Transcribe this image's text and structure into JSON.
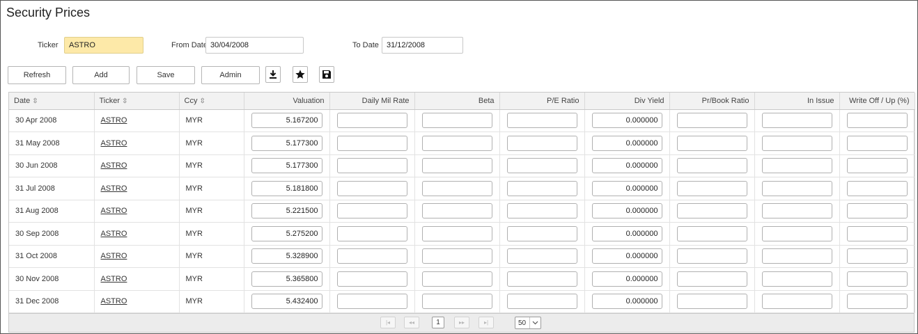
{
  "page": {
    "title": "Security Prices"
  },
  "filters": {
    "ticker_label": "Ticker",
    "ticker_value": "ASTRO",
    "from_label": "From Date*",
    "from_value": "30/04/2008",
    "to_label": "To Date",
    "to_value": "31/12/2008"
  },
  "toolbar": {
    "refresh_label": "Refresh",
    "add_label": "Add",
    "save_label": "Save",
    "admin_label": "Admin",
    "icons": [
      "download-icon",
      "star-icon",
      "floppy-disk-icon"
    ]
  },
  "grid": {
    "columns": [
      "Date",
      "Ticker",
      "Ccy",
      "Valuation",
      "Daily Mil Rate",
      "Beta",
      "P/E Ratio",
      "Div Yield",
      "Pr/Book Ratio",
      "In Issue",
      "Write Off / Up (%)"
    ],
    "sort_glyph": "⇳",
    "rows": [
      {
        "date": "30 Apr 2008",
        "ticker": "ASTRO",
        "ccy": "MYR",
        "valuation": "5.167200",
        "daily_mil_rate": "",
        "beta": "",
        "pe_ratio": "",
        "div_yield": "0.000000",
        "pr_book_ratio": "",
        "in_issue": "",
        "write_off": ""
      },
      {
        "date": "31 May 2008",
        "ticker": "ASTRO",
        "ccy": "MYR",
        "valuation": "5.177300",
        "daily_mil_rate": "",
        "beta": "",
        "pe_ratio": "",
        "div_yield": "0.000000",
        "pr_book_ratio": "",
        "in_issue": "",
        "write_off": ""
      },
      {
        "date": "30 Jun 2008",
        "ticker": "ASTRO",
        "ccy": "MYR",
        "valuation": "5.177300",
        "daily_mil_rate": "",
        "beta": "",
        "pe_ratio": "",
        "div_yield": "0.000000",
        "pr_book_ratio": "",
        "in_issue": "",
        "write_off": ""
      },
      {
        "date": "31 Jul 2008",
        "ticker": "ASTRO",
        "ccy": "MYR",
        "valuation": "5.181800",
        "daily_mil_rate": "",
        "beta": "",
        "pe_ratio": "",
        "div_yield": "0.000000",
        "pr_book_ratio": "",
        "in_issue": "",
        "write_off": ""
      },
      {
        "date": "31 Aug 2008",
        "ticker": "ASTRO",
        "ccy": "MYR",
        "valuation": "5.221500",
        "daily_mil_rate": "",
        "beta": "",
        "pe_ratio": "",
        "div_yield": "0.000000",
        "pr_book_ratio": "",
        "in_issue": "",
        "write_off": ""
      },
      {
        "date": "30 Sep 2008",
        "ticker": "ASTRO",
        "ccy": "MYR",
        "valuation": "5.275200",
        "daily_mil_rate": "",
        "beta": "",
        "pe_ratio": "",
        "div_yield": "0.000000",
        "pr_book_ratio": "",
        "in_issue": "",
        "write_off": ""
      },
      {
        "date": "31 Oct 2008",
        "ticker": "ASTRO",
        "ccy": "MYR",
        "valuation": "5.328900",
        "daily_mil_rate": "",
        "beta": "",
        "pe_ratio": "",
        "div_yield": "0.000000",
        "pr_book_ratio": "",
        "in_issue": "",
        "write_off": ""
      },
      {
        "date": "30 Nov 2008",
        "ticker": "ASTRO",
        "ccy": "MYR",
        "valuation": "5.365800",
        "daily_mil_rate": "",
        "beta": "",
        "pe_ratio": "",
        "div_yield": "0.000000",
        "pr_book_ratio": "",
        "in_issue": "",
        "write_off": ""
      },
      {
        "date": "31 Dec 2008",
        "ticker": "ASTRO",
        "ccy": "MYR",
        "valuation": "5.432400",
        "daily_mil_rate": "",
        "beta": "",
        "pe_ratio": "",
        "div_yield": "0.000000",
        "pr_book_ratio": "",
        "in_issue": "",
        "write_off": ""
      }
    ]
  },
  "pager": {
    "first_label": "|◂",
    "prev_label": "◂◂",
    "page_number": "1",
    "next_label": "▸▸",
    "last_label": "▸|",
    "page_size": "50"
  }
}
